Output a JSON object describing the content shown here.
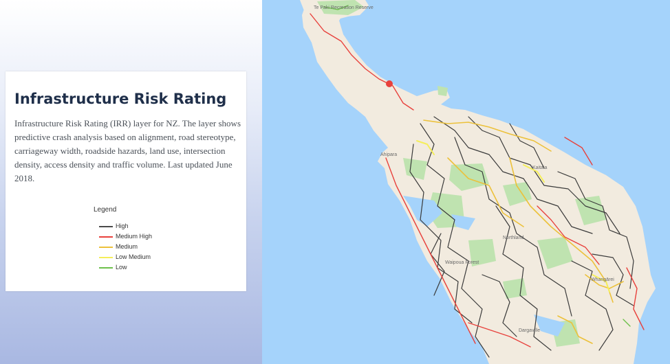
{
  "card": {
    "title": "Infrastructure Risk Rating",
    "description": "Infrastructure Risk Rating (IRR) layer for NZ. The layer shows predictive crash analysis based on alignment, road stereotype, carriageway width, roadside hazards, land use, intersection density, access density and traffic volume. Last updated June 2018."
  },
  "legend": {
    "title": "Legend",
    "items": [
      {
        "label": "High",
        "color": "#4a4a4a"
      },
      {
        "label": "Medium High",
        "color": "#e8413c"
      },
      {
        "label": "Medium",
        "color": "#ecc13a"
      },
      {
        "label": "Low Medium",
        "color": "#f5ee5a"
      },
      {
        "label": "Low",
        "color": "#6cc04a"
      }
    ]
  },
  "map": {
    "water_color": "#a5d3fb",
    "land_color": "#f2ebdf",
    "park_color": "#bfe3b0",
    "labels": [
      "Te Paki Recreation Reserve",
      "Ahipara",
      "Kaitaia",
      "Northland",
      "Waipoua Forest",
      "Whangārei",
      "Dargaville"
    ]
  }
}
